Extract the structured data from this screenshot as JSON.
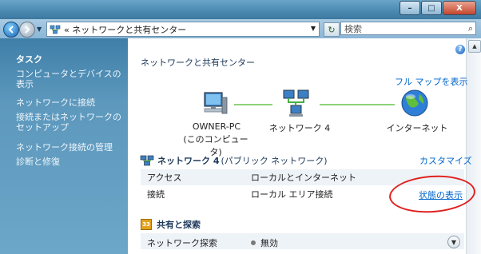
{
  "window": {
    "minimize_label": "–",
    "maximize_label": "□",
    "close_label": "X"
  },
  "address": {
    "breadcrumb": "« ネットワークと共有センター",
    "search_placeholder": "検索"
  },
  "sidebar": {
    "section_title": "タスク",
    "tasks": [
      "コンピュータとデバイスの表示",
      "ネットワークに接続",
      "接続またはネットワークのセットアップ",
      "ネットワーク接続の管理",
      "診断と修復"
    ]
  },
  "main": {
    "title": "ネットワークと共有センター",
    "full_map_link": "フル マップを表示",
    "map": {
      "computer_name": "OWNER-PC",
      "computer_sub": "(このコンピュータ)",
      "network_name": "ネットワーク 4",
      "internet": "インターネット"
    },
    "network": {
      "name": "ネットワーク 4",
      "type": "(パブリック ネットワーク)",
      "customize_link": "カスタマイズ",
      "rows": [
        {
          "key": "アクセス",
          "value": "ローカルとインターネット"
        },
        {
          "key": "接続",
          "value": "ローカル エリア接続"
        }
      ],
      "status_link": "状態の表示"
    },
    "sharing": {
      "title": "共有と探索",
      "rows": [
        {
          "key": "ネットワーク探索",
          "value": "無効"
        }
      ]
    }
  },
  "colors": {
    "link": "#0066cc",
    "annotation_ellipse": "#e0201e",
    "sidebar_bg": "#4f8cb5",
    "connector": "#8ed27a"
  }
}
